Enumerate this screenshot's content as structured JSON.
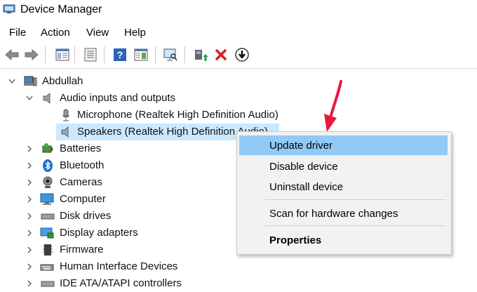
{
  "window": {
    "title": "Device Manager"
  },
  "menu": [
    "File",
    "Action",
    "View",
    "Help"
  ],
  "toolbar": {
    "buttons": [
      "back-icon",
      "forward-icon",
      "properties-pane-icon",
      "list-view-icon",
      "help-icon",
      "details-pane-icon",
      "scan-monitor-icon",
      "update-driver-icon",
      "uninstall-x-icon",
      "download-icon"
    ]
  },
  "tree": {
    "root": "Abdullah",
    "audio": {
      "label": "Audio inputs and outputs",
      "children": [
        "Microphone (Realtek High Definition Audio)",
        "Speakers (Realtek High Definition Audio)"
      ]
    },
    "categories": [
      "Batteries",
      "Bluetooth",
      "Cameras",
      "Computer",
      "Disk drives",
      "Display adapters",
      "Firmware",
      "Human Interface Devices",
      "IDE ATA/ATAPI controllers"
    ]
  },
  "context_menu": {
    "items": [
      "Update driver",
      "Disable device",
      "Uninstall device",
      "Scan for hardware changes",
      "Properties"
    ],
    "highlighted": "Update driver",
    "bold": "Properties"
  },
  "colors": {
    "selection": "#cce8ff",
    "menu_highlight": "#91c9f7",
    "arrow": "#e8183f"
  }
}
